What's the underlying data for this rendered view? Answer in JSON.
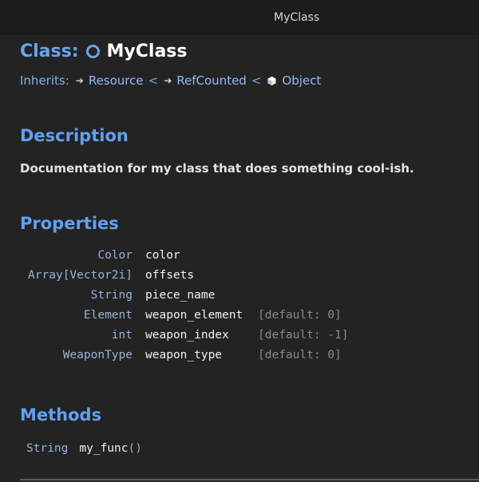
{
  "tab": {
    "title": "MyClass"
  },
  "header": {
    "class_keyword": "Class:",
    "class_name": "MyClass",
    "inherits_label": "Inherits:",
    "chain": [
      "Resource",
      "RefCounted",
      "Object"
    ],
    "separator": "<"
  },
  "description": {
    "heading": "Description",
    "text": "Documentation for my class that does something cool-ish."
  },
  "properties": {
    "heading": "Properties",
    "rows": [
      {
        "type": "Color",
        "name": "color",
        "default": ""
      },
      {
        "type": "Array[Vector2i]",
        "name": "offsets",
        "default": ""
      },
      {
        "type": "String",
        "name": "piece_name",
        "default": ""
      },
      {
        "type": "Element",
        "name": "weapon_element",
        "default": "[default: 0]"
      },
      {
        "type": "int",
        "name": "weapon_index",
        "default": "[default: -1]"
      },
      {
        "type": "WeaponType",
        "name": "weapon_type",
        "default": "[default: 0]"
      }
    ]
  },
  "methods": {
    "heading": "Methods",
    "rows": [
      {
        "return_type": "String",
        "name": "my_func",
        "params": "()"
      }
    ]
  },
  "icons": {
    "class": "circle-outline-icon",
    "inherit_arrow": "arrow-right-icon",
    "object": "cube-icon"
  },
  "colors": {
    "accent": "#62a0ee",
    "background": "#232323",
    "tabbar": "#1c1c1c"
  }
}
